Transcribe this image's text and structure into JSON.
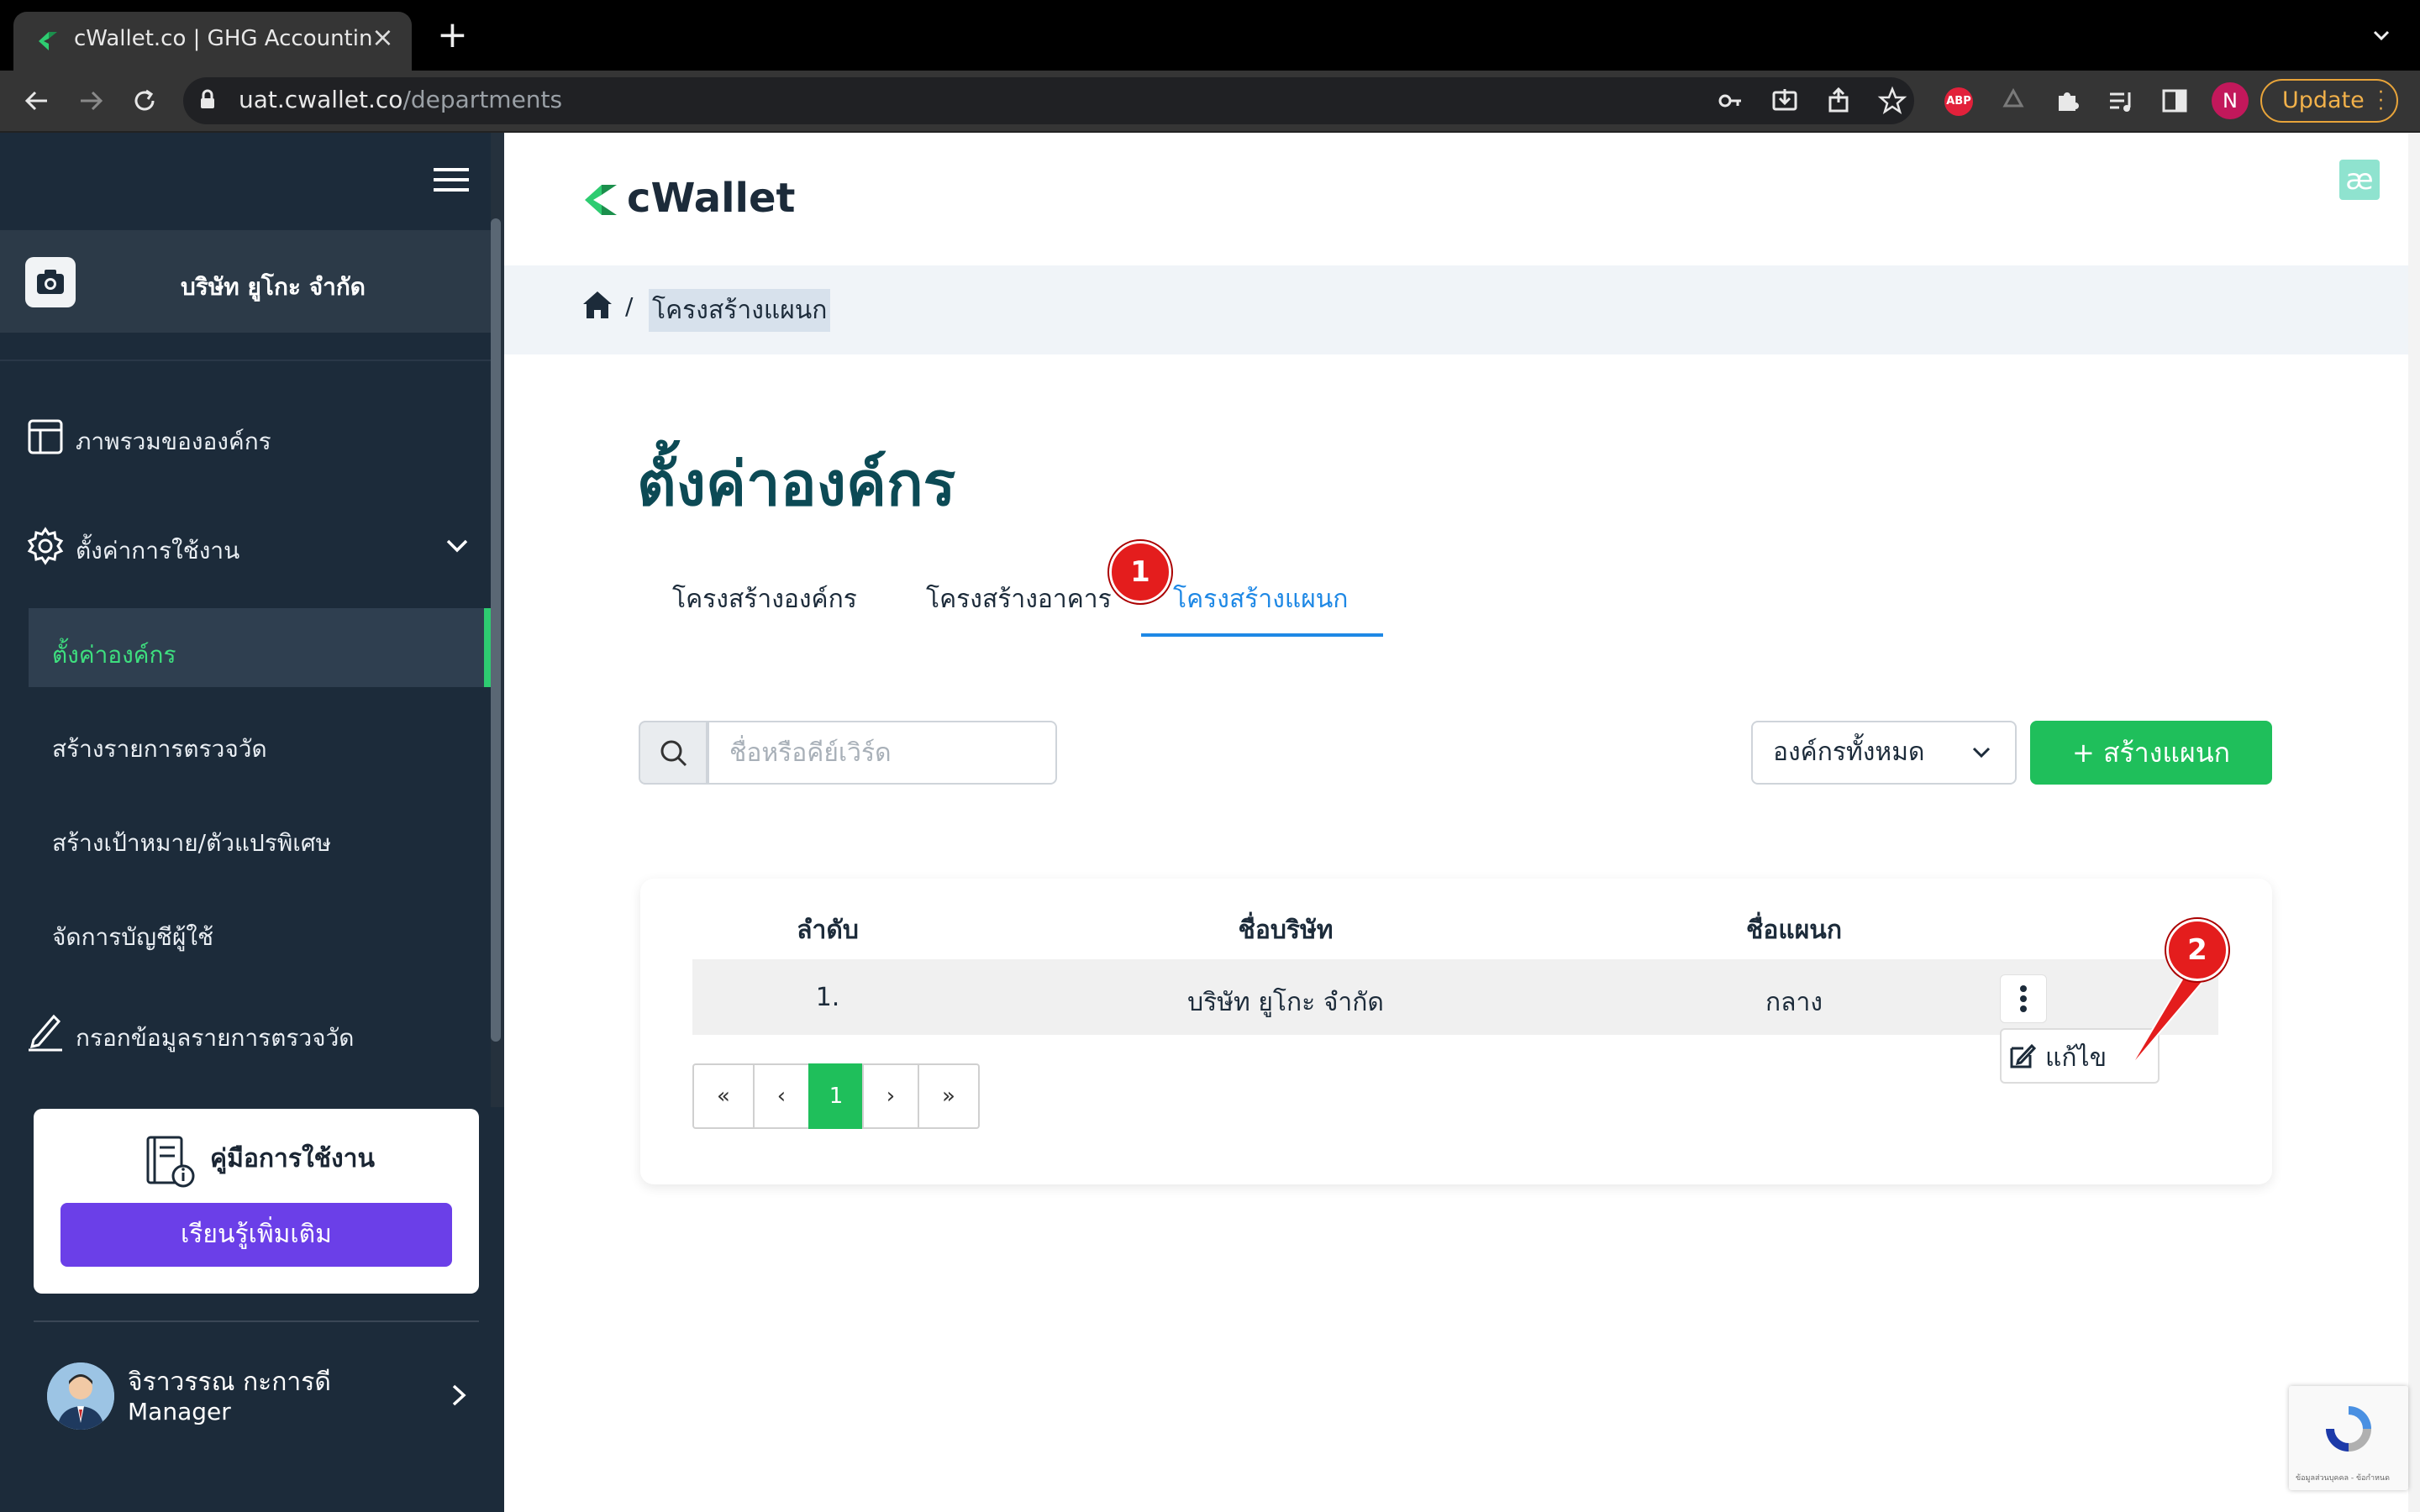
{
  "browser": {
    "tab_title": "cWallet.co | GHG Accounting S",
    "url_host": "uat.cwallet.co",
    "url_path": "/departments",
    "abp_label": "ABP",
    "profile_initial": "N",
    "update_label": "Update"
  },
  "sidebar": {
    "company_name": "บริษัท ยูโกะ จำกัด",
    "items": [
      {
        "label": "ภาพรวมขององค์กร",
        "icon": "layout-icon"
      },
      {
        "label": "ตั้งค่าการใช้งาน",
        "icon": "gear-icon"
      },
      {
        "label": "ตั้งค่าองค์กร",
        "active": true
      },
      {
        "label": "สร้างรายการตรวจวัด"
      },
      {
        "label": "สร้างเป้าหมาย/ตัวแปรพิเศษ"
      },
      {
        "label": "จัดการบัญชีผู้ใช้"
      },
      {
        "label": "กรอกข้อมูลรายการตรวจวัด",
        "icon": "pencil-icon"
      }
    ],
    "manual_title": "คู่มือการใช้งาน",
    "learn_more": "เรียนรู้เพิ่มเติม",
    "user_name": "จิราวรรณ กะการดี",
    "user_role": "Manager"
  },
  "main": {
    "brand": "cWallet",
    "ae_badge": "æ",
    "breadcrumb_current": "โครงสร้างแผนก",
    "breadcrumb_sep": "/",
    "page_title": "ตั้งค่าองค์กร",
    "tabs": [
      "โครงสร้างองค์กร",
      "โครงสร้างอาคาร",
      "โครงสร้างแผนก"
    ],
    "search_placeholder": "ชื่อหรือคีย์เวิร์ด",
    "org_filter": "องค์กรทั้งหมด",
    "create_button": "+ สร้างแผนก",
    "table": {
      "headers": [
        "ลำดับ",
        "ชื่อบริษัท",
        "ชื่อแผนก"
      ],
      "rows": [
        [
          "1.",
          "บริษัท ยูโกะ จำกัด",
          "กลาง"
        ]
      ]
    },
    "row_menu_edit": "แก้ไข",
    "pagination": {
      "first": "«",
      "prev": "‹",
      "current": "1",
      "next": "›",
      "last": "»"
    },
    "markers": [
      "1",
      "2"
    ],
    "recaptcha_text": "ข้อมูลส่วนบุคคล - ข้อกำหนด"
  },
  "colors": {
    "sidebar_bg": "#1c2b3a",
    "accent_green": "#1fbf5b",
    "tab_active": "#1e88e5",
    "learn_btn": "#6b3fe8",
    "marker_red": "#e41d1d"
  }
}
